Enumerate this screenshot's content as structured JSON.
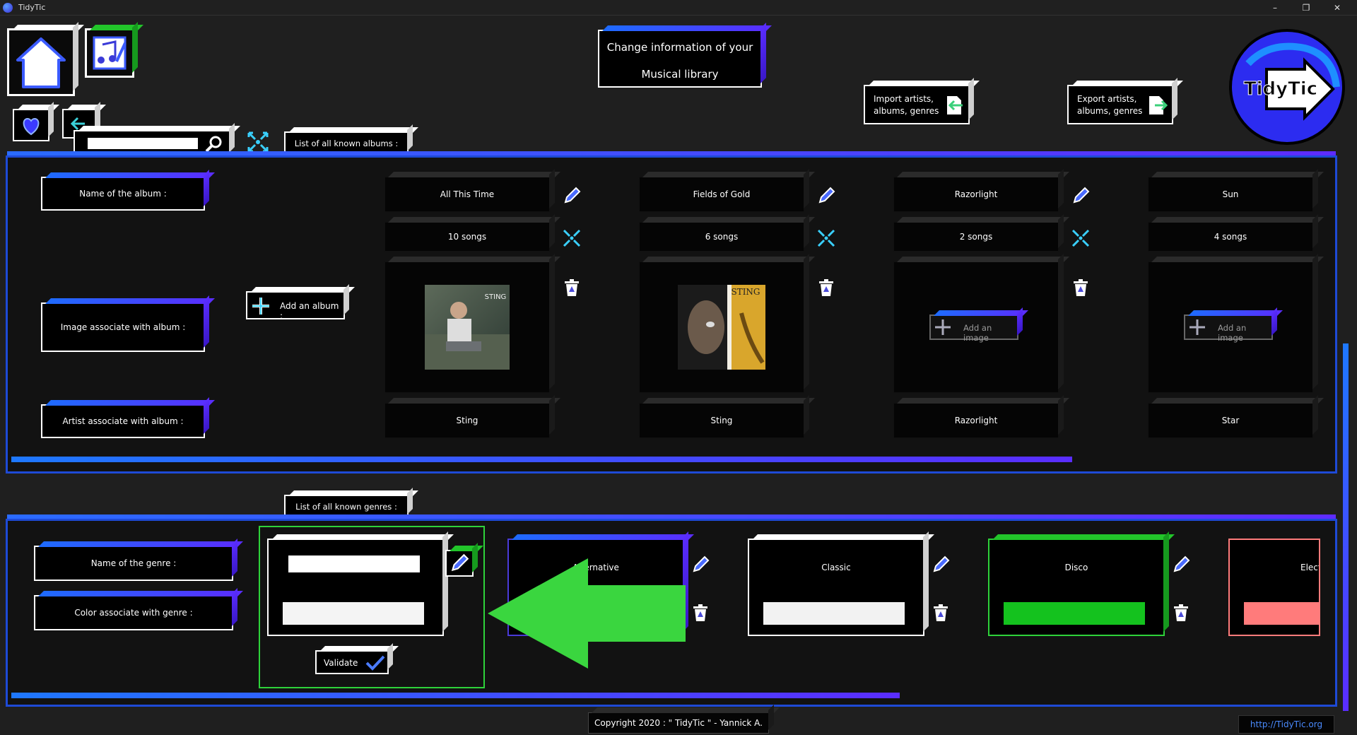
{
  "window": {
    "title": "TidyTic",
    "controls": [
      "–",
      "❐",
      "✕"
    ]
  },
  "header": {
    "title_line1": "Change information of your",
    "title_line2": "Musical library",
    "import_label_line1": "Import artists,",
    "import_label_line2": "albums, genres",
    "export_label_line1": "Export artists,",
    "export_label_line2": "albums, genres",
    "logo_text": "TidyTic"
  },
  "search": {
    "placeholder": ""
  },
  "albums": {
    "tab_label": "List of all known albums :",
    "row_labels": {
      "name": "Name of the album :",
      "image": "Image associate with album :",
      "artist": "Artist associate with album :"
    },
    "add_album_label": "Add an album :",
    "add_image_label": "Add an image",
    "items": [
      {
        "name": "All This Time",
        "songs": "10 songs",
        "artist": "Sting",
        "has_image": true,
        "cover_text": "STING"
      },
      {
        "name": "Fields of Gold",
        "songs": "6 songs",
        "artist": "Sting",
        "has_image": true,
        "cover_text": "STING"
      },
      {
        "name": "Razorlight",
        "songs": "2 songs",
        "artist": "Razorlight",
        "has_image": false
      },
      {
        "name": "Sun",
        "songs": "4 songs",
        "artist": "Star",
        "has_image": false
      }
    ],
    "scroll_fraction": 0.8
  },
  "genres": {
    "tab_label": "List of all known genres :",
    "row_labels": {
      "name": "Name of the genre :",
      "color": "Color associate with genre :"
    },
    "validate_label": "Validate",
    "new_genre": {
      "name_value": "",
      "color_value": ""
    },
    "items": [
      {
        "name": "Alternative",
        "color": "#7a3ad8"
      },
      {
        "name": "Classic",
        "color": "#f2f2f2"
      },
      {
        "name": "Disco",
        "color": "#14c21e"
      },
      {
        "name": "Elect",
        "color": "#ff7b7b"
      }
    ],
    "scroll_fraction": 0.67
  },
  "footer": {
    "copyright": "Copyright 2020 : \" TidyTic \" - Yannick A.",
    "link": "http://TidyTic.org"
  },
  "colors": {
    "accent_blue": "#1e6bff",
    "accent_purple": "#5a2dff",
    "highlight_green": "#2ed23a"
  }
}
